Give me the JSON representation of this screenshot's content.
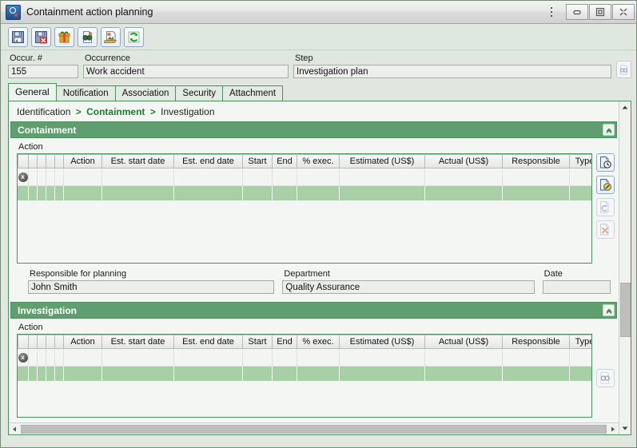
{
  "window": {
    "title": "Containment action planning",
    "app_icon": "search-badge-icon",
    "menu_icon": "kebab-menu-icon",
    "controls": [
      {
        "name": "minimize",
        "glyph": "minimize-icon"
      },
      {
        "name": "maximize",
        "glyph": "maximize-icon"
      },
      {
        "name": "close",
        "glyph": "close-icon"
      }
    ]
  },
  "toolbar": {
    "buttons": [
      {
        "name": "save-button",
        "icon": "floppy-save-icon",
        "title": "Save"
      },
      {
        "name": "save-close-button",
        "icon": "floppy-delete-icon",
        "title": "Save and close"
      },
      {
        "name": "package-button",
        "icon": "gift-package-icon",
        "title": "Package"
      },
      {
        "name": "find-button",
        "icon": "binoculars-document-icon",
        "title": "Find"
      },
      {
        "name": "print-button",
        "icon": "print-document-icon",
        "title": "Print"
      },
      {
        "name": "refresh-button",
        "icon": "refresh-green-icon",
        "title": "Refresh"
      }
    ]
  },
  "header_fields": {
    "occurrence_number": {
      "label": "Occur. #",
      "value": "155"
    },
    "occurrence": {
      "label": "Occurrence",
      "value": "Work accident"
    },
    "step": {
      "label": "Step",
      "value": "Investigation plan"
    },
    "step_lookup_icon": "binoculars-icon"
  },
  "tabs": [
    {
      "label": "General",
      "active": true
    },
    {
      "label": "Notification",
      "active": false
    },
    {
      "label": "Association",
      "active": false
    },
    {
      "label": "Security",
      "active": false
    },
    {
      "label": "Attachment",
      "active": false
    }
  ],
  "breadcrumb": {
    "items": [
      "Identification",
      "Containment",
      "Investigation"
    ],
    "separator": ">",
    "current": "Containment"
  },
  "grid_columns": [
    {
      "label": "",
      "width": 14
    },
    {
      "label": "",
      "width": 11
    },
    {
      "label": "",
      "width": 11
    },
    {
      "label": "",
      "width": 11
    },
    {
      "label": "",
      "width": 11
    },
    {
      "label": "Action",
      "width": 48
    },
    {
      "label": "Est. start date",
      "width": 90
    },
    {
      "label": "Est. end date",
      "width": 86
    },
    {
      "label": "Start",
      "width": 37
    },
    {
      "label": "End",
      "width": 31
    },
    {
      "label": "% exec.",
      "width": 53
    },
    {
      "label": "Estimated (US$)",
      "width": 107
    },
    {
      "label": "Actual (US$)",
      "width": 97
    },
    {
      "label": "Responsible",
      "width": 84
    },
    {
      "label": "Type",
      "width": 38
    }
  ],
  "containment": {
    "title": "Containment",
    "collapse_icon": "collapse-chevron-icon",
    "grid_label": "Action",
    "row_marker": "x",
    "rows": [
      {
        "marker": true,
        "selected": false
      },
      {
        "marker": false,
        "selected": true
      }
    ],
    "side_buttons": [
      {
        "name": "new-action-button",
        "icon": "document-clock-icon",
        "enabled": true
      },
      {
        "name": "edit-action-button",
        "icon": "document-pencil-icon",
        "enabled": true
      },
      {
        "name": "duplicate-action-button",
        "icon": "document-refresh-icon",
        "enabled": false
      },
      {
        "name": "delete-action-button",
        "icon": "document-delete-icon",
        "enabled": false
      }
    ]
  },
  "planning_fields": {
    "responsible": {
      "label": "Responsible for planning",
      "value": "John Smith"
    },
    "department": {
      "label": "Department",
      "value": "Quality Assurance"
    },
    "date": {
      "label": "Date",
      "value": ""
    }
  },
  "investigation": {
    "title": "Investigation",
    "collapse_icon": "collapse-chevron-icon",
    "grid_label": "Action",
    "row_marker": "x",
    "rows": [
      {
        "marker": true,
        "selected": false
      },
      {
        "marker": false,
        "selected": true
      }
    ],
    "side_buttons": [
      {
        "name": "find-investigation-button",
        "icon": "binoculars-icon",
        "enabled": false
      }
    ]
  },
  "scrollbars": {
    "vertical": {
      "up_icon": "scroll-up-icon",
      "down_icon": "scroll-down-icon"
    },
    "horizontal": {
      "left_icon": "scroll-left-icon",
      "right_icon": "scroll-right-icon"
    }
  },
  "colors": {
    "section_header": "#5f9e6e",
    "selected_row": "#a8cfa5",
    "border_green": "#4f8f5f",
    "breadcrumb_current": "#1e7a32",
    "window_bg": "#dfe7df",
    "field_bg": "#eceeec"
  }
}
